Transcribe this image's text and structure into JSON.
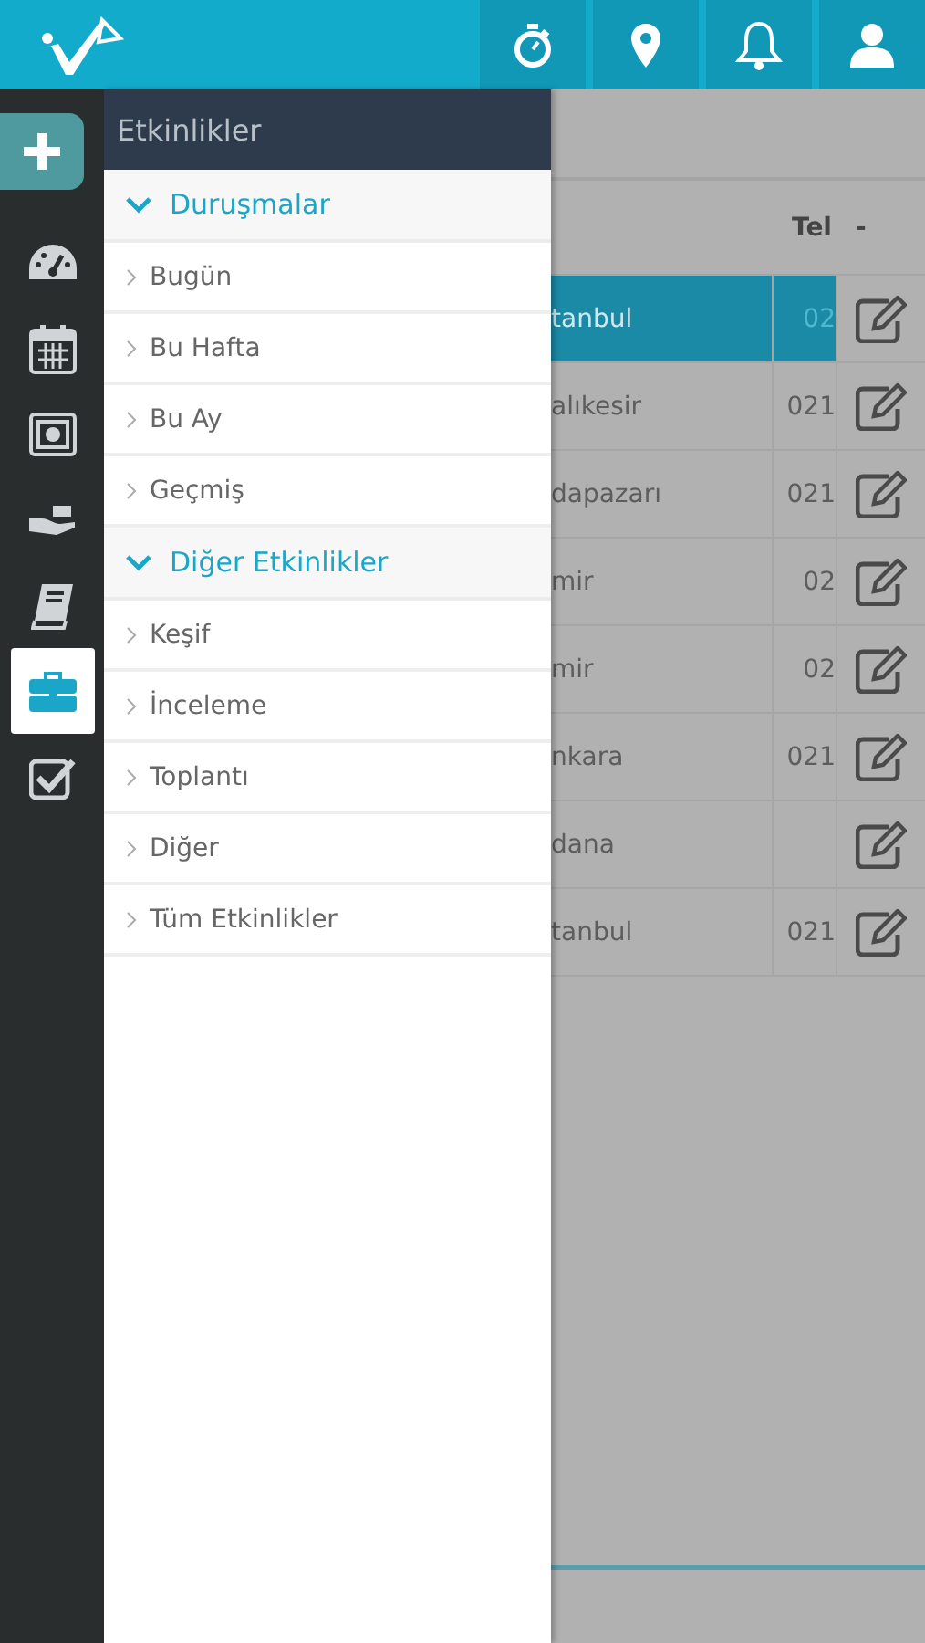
{
  "rail": {
    "items": [
      {
        "selected": false
      },
      {
        "selected": false
      },
      {
        "selected": false
      },
      {
        "selected": false
      },
      {
        "selected": false
      },
      {
        "selected": true
      },
      {
        "selected": false
      }
    ]
  },
  "panel": {
    "title": "Etkinlikler",
    "sections": [
      {
        "title": "Duruşmalar",
        "expanded": true,
        "items": [
          "Bugün",
          "Bu Hafta",
          "Bu Ay",
          "Geçmiş"
        ]
      },
      {
        "title": "Diğer Etkinlikler",
        "expanded": true,
        "items": [
          "Keşif",
          "İnceleme",
          "Toplantı",
          "Diğer",
          "Tüm Etkinlikler"
        ]
      }
    ]
  },
  "table": {
    "columns": [
      "Tel",
      "-"
    ],
    "rows": [
      {
        "city": "tanbul",
        "tel": "02",
        "selected": true
      },
      {
        "city": "alıkesir",
        "tel": "021",
        "selected": false
      },
      {
        "city": "dapazarı",
        "tel": "021",
        "selected": false
      },
      {
        "city": "mir",
        "tel": "02",
        "selected": false
      },
      {
        "city": "mir",
        "tel": "02",
        "selected": false
      },
      {
        "city": "nkara",
        "tel": "021",
        "selected": false
      },
      {
        "city": "dana",
        "selected": false
      },
      {
        "city": "tanbul",
        "tel": "021",
        "selected": false
      }
    ]
  }
}
